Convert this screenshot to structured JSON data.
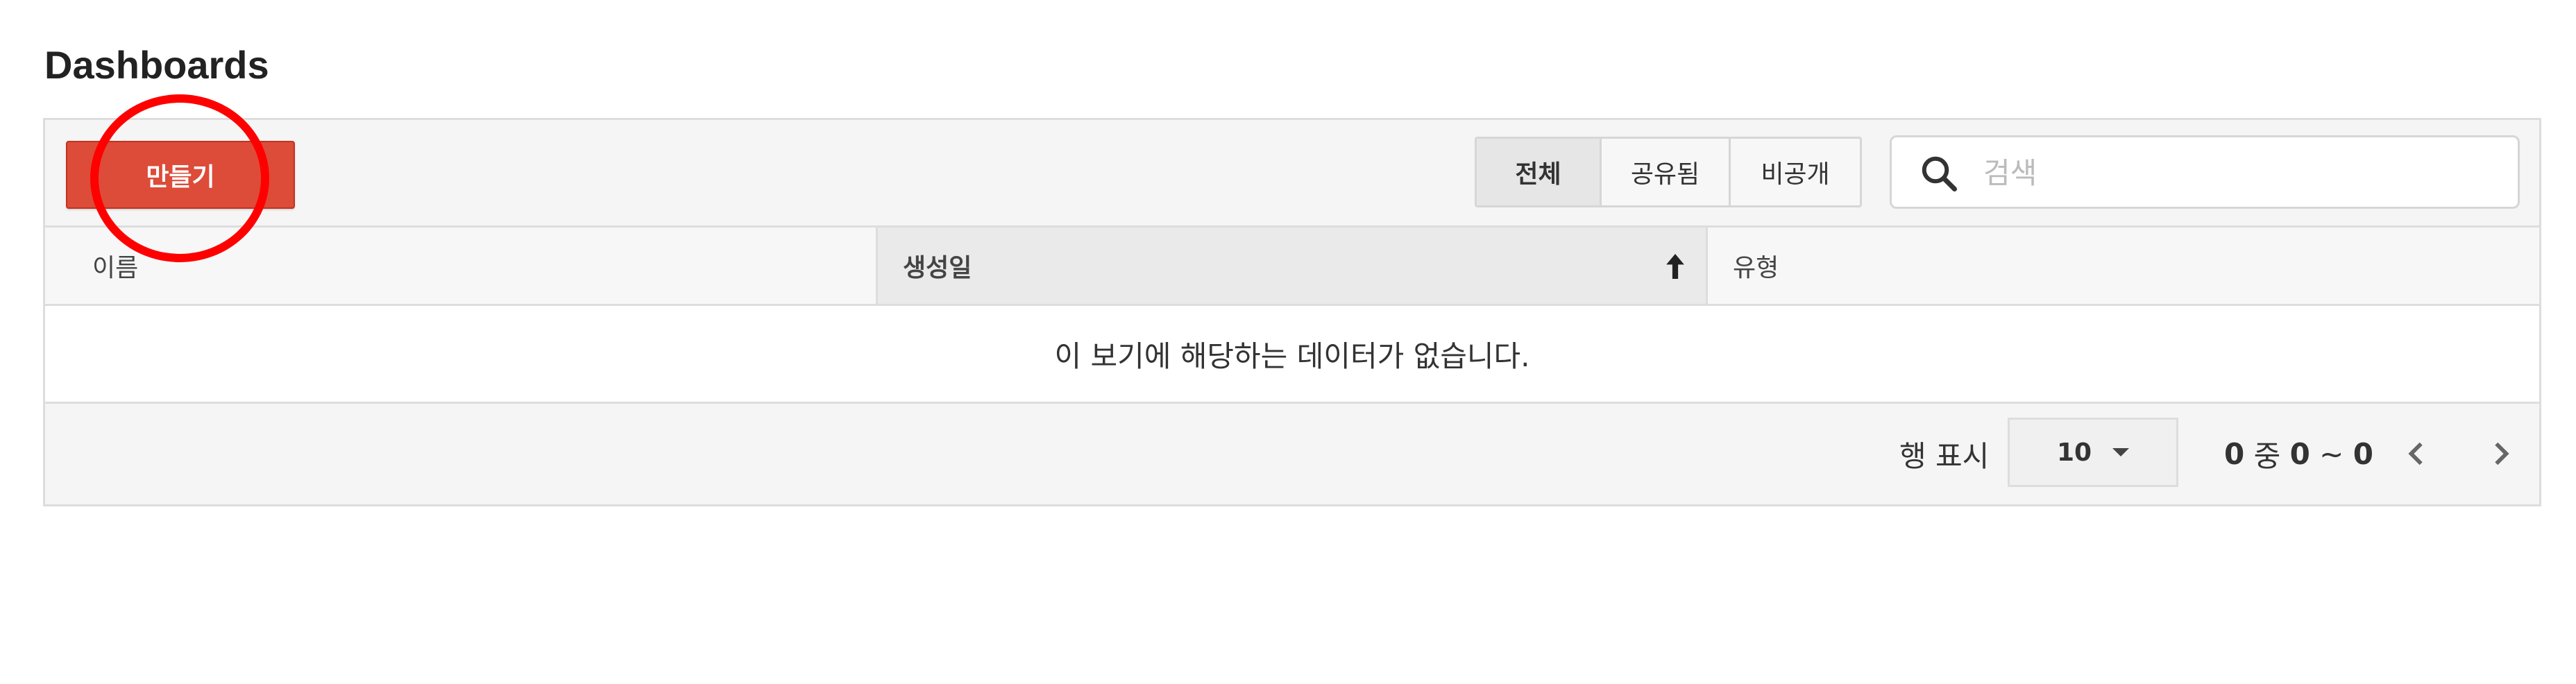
{
  "page": {
    "title": "Dashboards"
  },
  "toolbar": {
    "create_label": "만들기",
    "create_color": "#dd4b39",
    "filters": [
      {
        "label": "전체",
        "active": true
      },
      {
        "label": "공유됨",
        "active": false
      },
      {
        "label": "비공개",
        "active": false
      }
    ],
    "search": {
      "placeholder": "검색",
      "value": "",
      "icon": "search-icon"
    }
  },
  "table": {
    "columns": [
      {
        "label": "이름"
      },
      {
        "label": "생성일",
        "sorted": "ascending",
        "icon": "sort-arrow-up-icon"
      },
      {
        "label": "유형"
      }
    ],
    "empty_message": "이 보기에 해당하는 데이터가 없습니다."
  },
  "footer": {
    "rows_label": "행 표시",
    "rows_value": "10",
    "range_start": "0",
    "range_sep1": " 중 ",
    "range_from": "0",
    "range_sep2": " ~ ",
    "range_to": "0"
  },
  "annotation": {
    "highlight_color": "#ff0000",
    "target": "create-button"
  }
}
